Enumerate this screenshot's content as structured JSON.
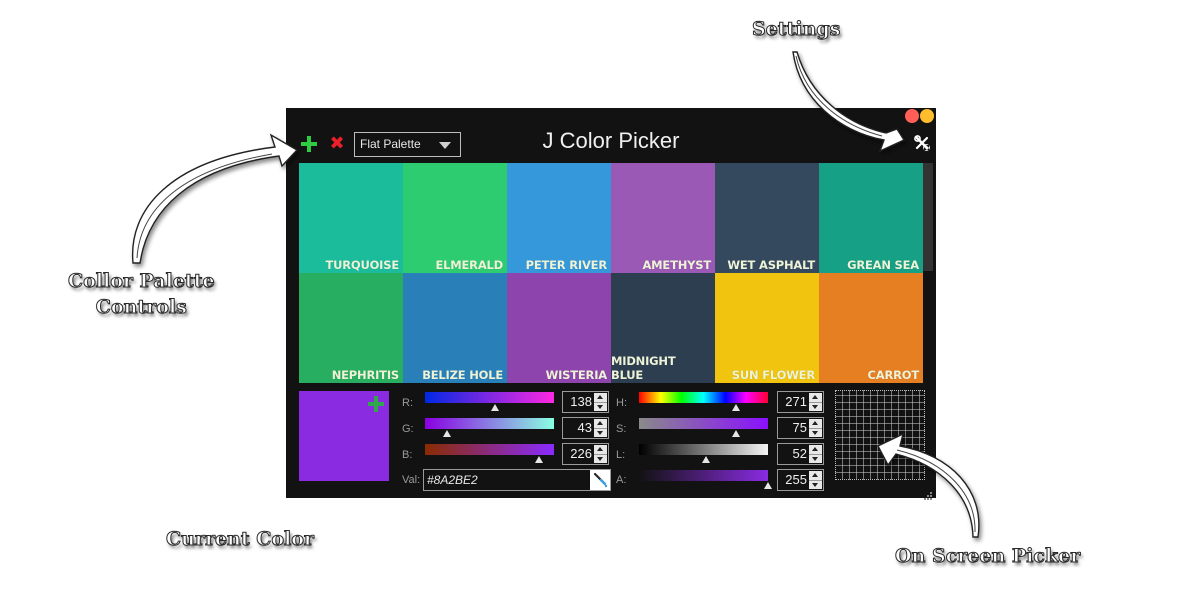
{
  "annotations": {
    "settings": "Settings",
    "palette_controls_line1": "Collor Palette",
    "palette_controls_line2": "Controls",
    "current_color": "Current Color",
    "on_screen_picker": "On Screen Picker"
  },
  "window": {
    "title": "J Color Picker",
    "palette_select": {
      "selected": "Flat Palette"
    },
    "icons": {
      "add": "plus-icon",
      "delete": "x-icon",
      "settings": "wrench-screwdriver-icon",
      "close": "red-dot-icon",
      "minimize": "yellow-dot-icon"
    },
    "delete_glyph": "✖"
  },
  "swatches": [
    {
      "name": "TURQUOISE",
      "color": "#1ABC9C"
    },
    {
      "name": "ELMERALD",
      "color": "#2ECC71"
    },
    {
      "name": "PETER RIVER",
      "color": "#3498DB"
    },
    {
      "name": "AMETHYST",
      "color": "#9B59B6"
    },
    {
      "name": "WET ASPHALT",
      "color": "#34495E"
    },
    {
      "name": "GREAN SEA",
      "color": "#16A085"
    },
    {
      "name": "NEPHRITIS",
      "color": "#27AE60"
    },
    {
      "name": "BELIZE HOLE",
      "color": "#2980B9"
    },
    {
      "name": "WISTERIA",
      "color": "#8E44AD"
    },
    {
      "name": "MIDNIGHT BLUE",
      "color": "#2C3E50"
    },
    {
      "name": "SUN FLOWER",
      "color": "#F1C40F"
    },
    {
      "name": "CARROT",
      "color": "#E67E22"
    }
  ],
  "current_color": {
    "hex": "#8A2BE2"
  },
  "rgb": {
    "r": {
      "label": "R:",
      "value": "138",
      "fraction": 0.541
    },
    "g": {
      "label": "G:",
      "value": "43",
      "fraction": 0.169
    },
    "b": {
      "label": "B:",
      "value": "226",
      "fraction": 0.886
    }
  },
  "hsla": {
    "h": {
      "label": "H:",
      "value": "271",
      "fraction": 0.753
    },
    "s": {
      "label": "S:",
      "value": "75",
      "fraction": 0.75
    },
    "l": {
      "label": "L:",
      "value": "52",
      "fraction": 0.52
    },
    "a": {
      "label": "A:",
      "value": "255",
      "fraction": 1.0
    }
  },
  "val": {
    "label": "Val:",
    "value": "#8A2BE2"
  },
  "colors": {
    "window_bg": "#121212",
    "accent_green": "#2ECC40",
    "delete_red": "#E8202A"
  }
}
